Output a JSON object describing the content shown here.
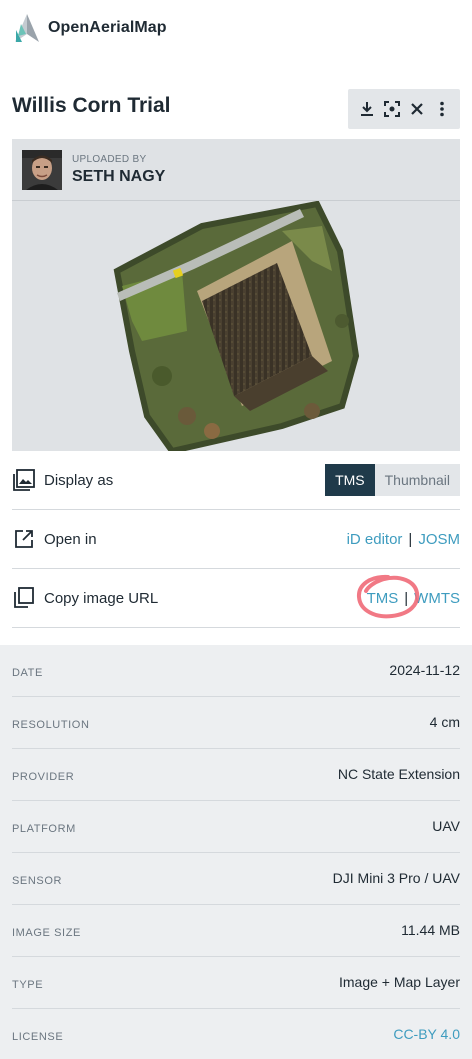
{
  "app": {
    "name": "OpenAerialMap"
  },
  "image": {
    "title": "Willis Corn Trial"
  },
  "toolbar": {
    "icons": [
      "download-icon",
      "focus-icon",
      "close-icon",
      "more-vertical-icon"
    ]
  },
  "uploader": {
    "caption": "UPLOADED BY",
    "name": "SETH NAGY"
  },
  "actions": {
    "display_as": {
      "label": "Display as",
      "options": [
        "TMS",
        "Thumbnail"
      ],
      "selected": "TMS"
    },
    "open_in": {
      "label": "Open in",
      "links": [
        "iD editor",
        "JOSM"
      ],
      "separator": "|"
    },
    "copy_url": {
      "label": "Copy image URL",
      "links": [
        "TMS",
        "WMTS"
      ],
      "separator": "|"
    }
  },
  "metadata": [
    {
      "key": "DATE",
      "value": "2024-11-12"
    },
    {
      "key": "RESOLUTION",
      "value": "4 cm"
    },
    {
      "key": "PROVIDER",
      "value": "NC State Extension"
    },
    {
      "key": "PLATFORM",
      "value": "UAV"
    },
    {
      "key": "SENSOR",
      "value": "DJI Mini 3 Pro / UAV"
    },
    {
      "key": "IMAGE SIZE",
      "value": "11.44 MB"
    },
    {
      "key": "TYPE",
      "value": "Image + Map Layer"
    },
    {
      "key": "LICENSE",
      "value": "CC-BY 4.0"
    }
  ],
  "colors": {
    "accent": "#3e9cbf",
    "toggle_active": "#1f3a4a",
    "annotation": "#f06a78"
  }
}
